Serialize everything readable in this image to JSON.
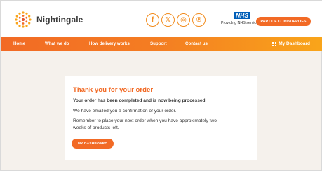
{
  "header": {
    "brand": "Nightingale",
    "social": [
      {
        "name": "facebook",
        "glyph": "f"
      },
      {
        "name": "x-twitter",
        "glyph": "𝕏"
      },
      {
        "name": "instagram",
        "glyph": "◎"
      },
      {
        "name": "pinterest",
        "glyph": "℗"
      }
    ],
    "nhs_logo": "NHS",
    "nhs_text": "Providing NHS services",
    "part_of": "PART OF CLINISUPPLIES"
  },
  "nav": {
    "items": [
      "Home",
      "What we do",
      "How delivery works",
      "Support",
      "Contact us"
    ],
    "dashboard": "My Dashboard"
  },
  "confirmation": {
    "title": "Thank you for your order",
    "line1": "Your order has been completed and is now being processed.",
    "line2": "We have emailed you a confirmation of your order.",
    "line3a": "Remember to place your next order when you have approximately two",
    "line3b": "weeks of products left.",
    "button": "MY DASHBOARD"
  },
  "colors": {
    "accent": "#f26a25",
    "nav_gradient_end": "#f9a51a",
    "background": "#f5f1ec",
    "nhs_blue": "#005eb8"
  }
}
